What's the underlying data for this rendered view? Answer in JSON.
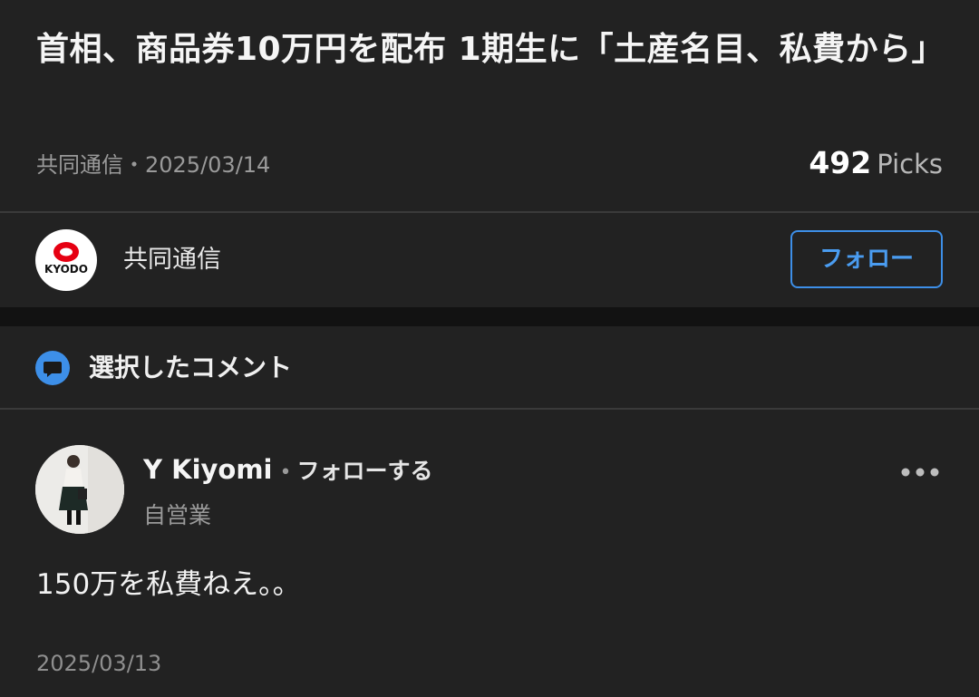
{
  "article": {
    "title": "首相、商品券10万円を配布 1期生に「土産名目、私費から」",
    "source": "共同通信",
    "separator": "・",
    "date": "2025/03/14",
    "picks_count": "492",
    "picks_label": "Picks"
  },
  "publisher": {
    "logo_text": "KYODO",
    "name": "共同通信",
    "follow_label": "フォロー"
  },
  "selected_comments": {
    "title": "選択したコメント"
  },
  "comment": {
    "user_name": "Y Kiyomi",
    "separator": "•",
    "follow_label": "フォローする",
    "job": "自営業",
    "body": "150万を私費ねえ。。",
    "date": "2025/03/13"
  },
  "icons": {
    "chat": "chat-bubble-icon",
    "more": "more-horizontal-icon",
    "avatar": "user-avatar-photo"
  },
  "colors": {
    "background": "#222222",
    "accent": "#3d8fe8",
    "muted_text": "#9a9a9a",
    "logo_red": "#e60012"
  }
}
